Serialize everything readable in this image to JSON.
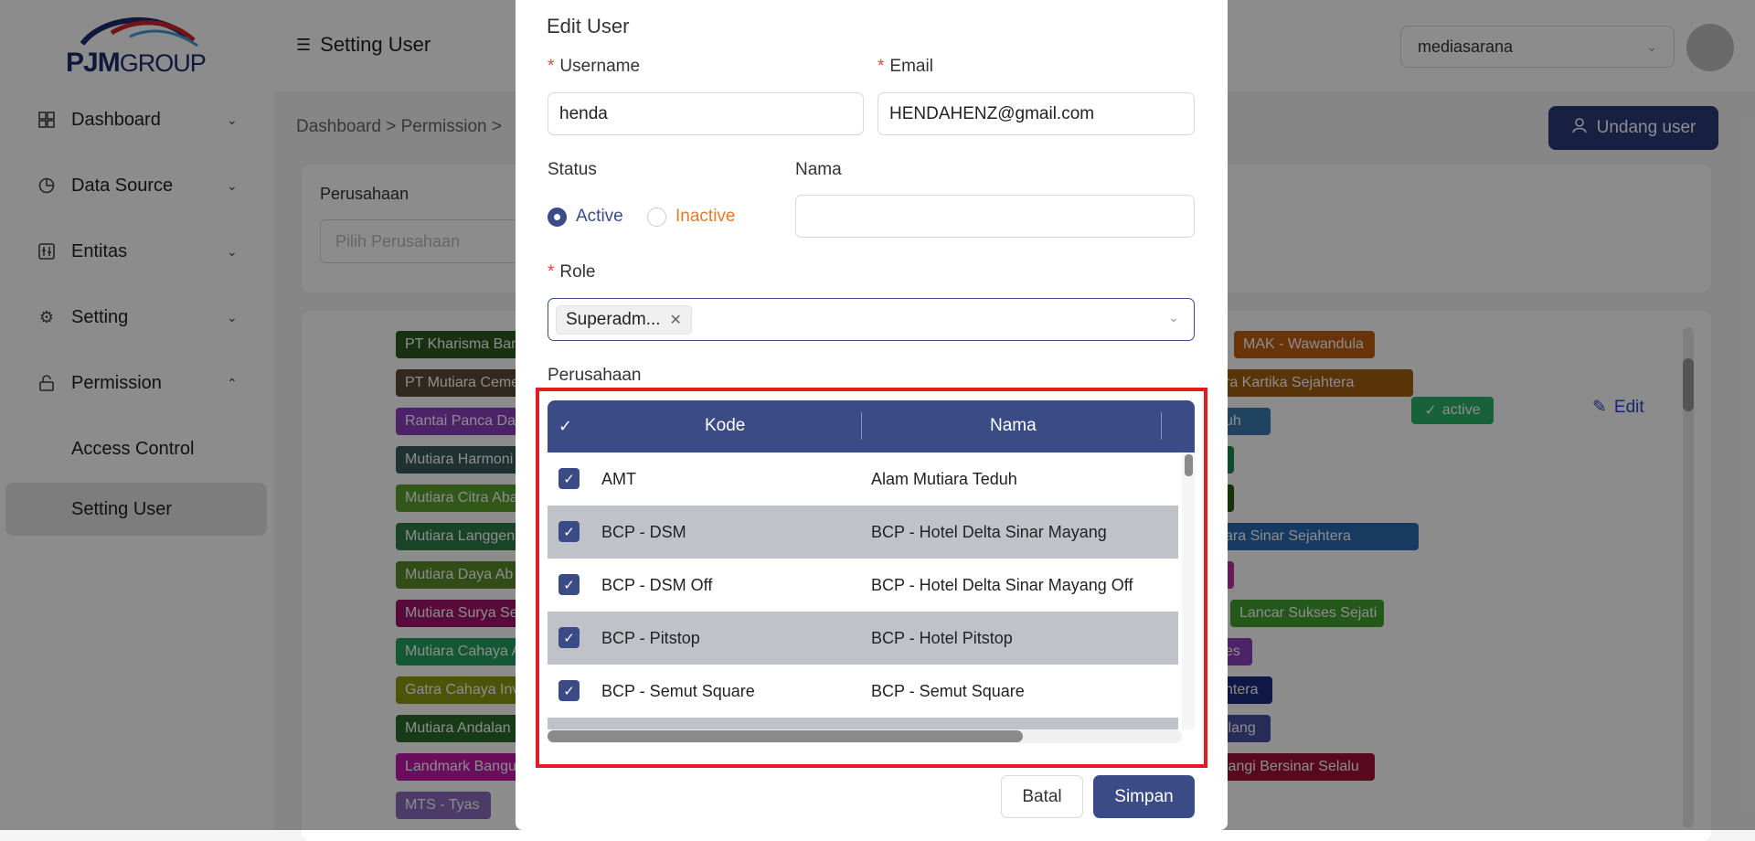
{
  "brand": {
    "logo_bold": "PJM",
    "logo_light": "GROUP"
  },
  "sidebar": {
    "items": [
      {
        "label": "Dashboard",
        "icon": "dashboard-icon"
      },
      {
        "label": "Data Source",
        "icon": "pie-chart-icon"
      },
      {
        "label": "Entitas",
        "icon": "entity-icon"
      },
      {
        "label": "Setting",
        "icon": "gear-icon"
      },
      {
        "label": "Permission",
        "icon": "lock-icon"
      }
    ],
    "sub_items": [
      {
        "label": "Access Control"
      },
      {
        "label": "Setting User",
        "active": true
      }
    ]
  },
  "header": {
    "title": "Setting User",
    "company_select": "mediasarana"
  },
  "main": {
    "breadcrumb": "Dashboard  >  Permission  >",
    "invite_button": "Undang user",
    "filter_label": "Perusahaan",
    "filter_placeholder": "Pilih Perusahaan",
    "status": "active",
    "edit_label": "Edit",
    "tags_left": [
      {
        "text": "PT Kharisma Ban",
        "color": "#2d5a1e"
      },
      {
        "text": "PT Mutiara Ceme",
        "color": "#5a4a3a"
      },
      {
        "text": "Rantai Panca Day",
        "color": "#8a3fbf"
      },
      {
        "text": "Mutiara Harmoni",
        "color": "#3a5a5a"
      },
      {
        "text": "Mutiara Citra Aba",
        "color": "#5aa02c"
      },
      {
        "text": "Mutiara Langgen",
        "color": "#2e7d4a"
      },
      {
        "text": "Mutiara Daya Ab",
        "color": "#5a8a2a"
      },
      {
        "text": "Mutiara Surya Se",
        "color": "#a0156a"
      },
      {
        "text": "Mutiara Cahaya A",
        "color": "#22a060"
      },
      {
        "text": "Gatra Cahaya Inv",
        "color": "#8a9a10"
      },
      {
        "text": "Mutiara Andalan",
        "color": "#2a6a2a"
      },
      {
        "text": "Landmark Bangu",
        "color": "#c019a8"
      },
      {
        "text": "MTS - Tyas",
        "color": "#8a6ac0"
      }
    ],
    "tags_right": [
      {
        "text": "MAK - Wawandula",
        "color": "#c0600f"
      },
      {
        "text": "ra Kartika Sejahtera",
        "color": "#a06010"
      },
      {
        "text": "uh",
        "color": "#3a7ab0"
      },
      {
        "text": "",
        "color": "#1a8a50"
      },
      {
        "text": "",
        "color": "#2a5a10"
      },
      {
        "text": "ara Sinar Sejahtera",
        "color": "#2a6ab0"
      },
      {
        "text": "",
        "color": "#c030a0"
      },
      {
        "text": "Lancar Sukses Sejati",
        "color": "#40a030"
      },
      {
        "text": "es",
        "color": "#8a40c0"
      },
      {
        "text": "ntera",
        "color": "#1a2a80"
      },
      {
        "text": "ilang",
        "color": "#4a50a0"
      },
      {
        "text": "langi Bersinar Selalu",
        "color": "#a0103a"
      }
    ]
  },
  "modal": {
    "title": "Edit User",
    "username_label": "Username",
    "username_value": "henda",
    "email_label": "Email",
    "email_value": "HENDAHENZ@gmail.com",
    "status_label": "Status",
    "status_active": "Active",
    "status_inactive": "Inactive",
    "nama_label": "Nama",
    "nama_value": "",
    "role_label": "Role",
    "role_tag": "Superadm...",
    "perusahaan_label": "Perusahaan",
    "grid": {
      "col_kode": "Kode",
      "col_nama": "Nama",
      "rows": [
        {
          "kode": "AMT",
          "nama": "Alam Mutiara Teduh",
          "checked": true
        },
        {
          "kode": "BCP - DSM",
          "nama": "BCP - Hotel Delta Sinar Mayang",
          "checked": true
        },
        {
          "kode": "BCP - DSM Off",
          "nama": "BCP - Hotel Delta Sinar Mayang Off",
          "checked": true
        },
        {
          "kode": "BCP - Pitstop",
          "nama": "BCP - Hotel Pitstop",
          "checked": true
        },
        {
          "kode": "BCP - Semut Square",
          "nama": "BCP - Semut Square",
          "checked": true
        }
      ]
    },
    "cancel_button": "Batal",
    "save_button": "Simpan"
  }
}
